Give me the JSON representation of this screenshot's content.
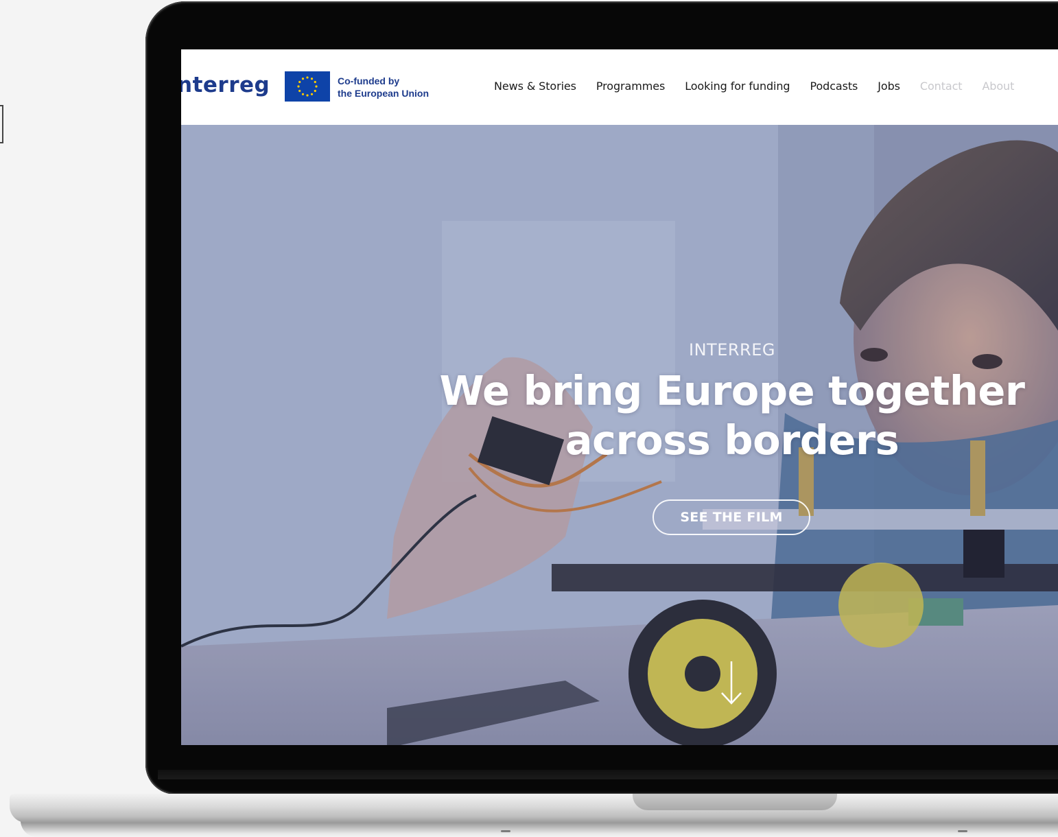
{
  "brand": {
    "logo_text": "nterreg",
    "cofunded_line1": "Co-funded by",
    "cofunded_line2": "the European Union",
    "flag_icon": "eu-flag-icon"
  },
  "nav": {
    "items": [
      {
        "label": "News & Stories",
        "state": "normal"
      },
      {
        "label": "Programmes",
        "state": "normal"
      },
      {
        "label": "Looking for funding",
        "state": "normal"
      },
      {
        "label": "Podcasts",
        "state": "normal"
      },
      {
        "label": "Jobs",
        "state": "normal"
      },
      {
        "label": "Contact",
        "state": "faded"
      },
      {
        "label": "About",
        "state": "faded"
      }
    ]
  },
  "hero": {
    "kicker": "INTERREG",
    "headline_line1": "We bring Europe together",
    "headline_line2": "across borders",
    "cta_label": "SEE THE FILM",
    "scroll_icon": "arrow-down-icon"
  },
  "colors": {
    "brand_blue": "#1d3b8c",
    "eu_blue": "#0e43a8",
    "eu_star": "#ffcc00",
    "hero_tint": "#9aa6c2",
    "nav_faded": "#c8c8cc",
    "page_background": "#f4f4f4",
    "laptop_bezel": "#070707"
  }
}
